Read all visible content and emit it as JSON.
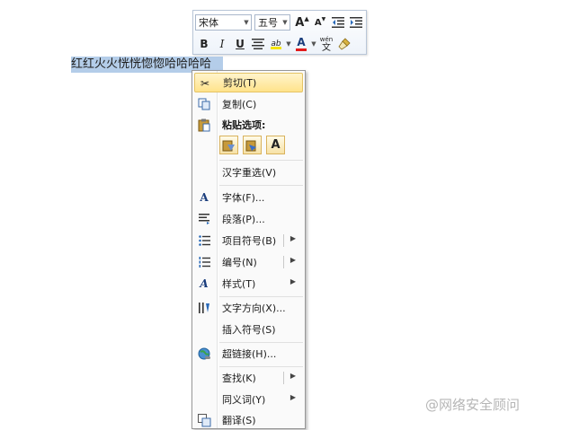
{
  "document": {
    "selected_text": "红红火火恍恍惚惚哈哈哈哈"
  },
  "mini_toolbar": {
    "font_name": "宋体",
    "font_size": "五号",
    "grow_font": "A",
    "shrink_font": "A",
    "bold": "B",
    "italic": "I",
    "underline": "U",
    "font_color": "A",
    "phonetic": "wén",
    "phonetic_char": "文",
    "highlight_label": "ab",
    "colors": {
      "highlight": "#f5e50a",
      "font_color": "#e21b1b"
    }
  },
  "context_menu": {
    "cut": "剪切(T)",
    "copy": "复制(C)",
    "paste_options": "粘贴选项:",
    "paste_text_only": "A",
    "reconvert": "汉字重选(V)",
    "font": "字体(F)...",
    "paragraph": "段落(P)...",
    "bullets": "项目符号(B)",
    "numbering": "编号(N)",
    "styles": "样式(T)",
    "text_direction": "文字方向(X)...",
    "insert_symbol": "插入符号(S)",
    "hyperlink": "超链接(H)...",
    "find": "查找(K)",
    "synonyms": "同义词(Y)",
    "translate": "翻译(S)"
  },
  "watermark": "@网络安全顾问"
}
